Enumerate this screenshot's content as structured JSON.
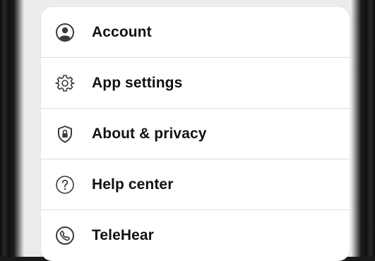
{
  "menu": {
    "items": [
      {
        "label": "Account",
        "icon": "account-circle-icon"
      },
      {
        "label": "App settings",
        "icon": "gear-icon"
      },
      {
        "label": "About & privacy",
        "icon": "shield-lock-icon"
      },
      {
        "label": "Help center",
        "icon": "question-circle-icon"
      },
      {
        "label": "TeleHear",
        "icon": "phone-circle-icon"
      }
    ]
  },
  "colors": {
    "text": "#111111",
    "icon": "#3a3a3a",
    "card": "#ffffff",
    "divider": "#dcdcdf",
    "background": "#ececef"
  }
}
